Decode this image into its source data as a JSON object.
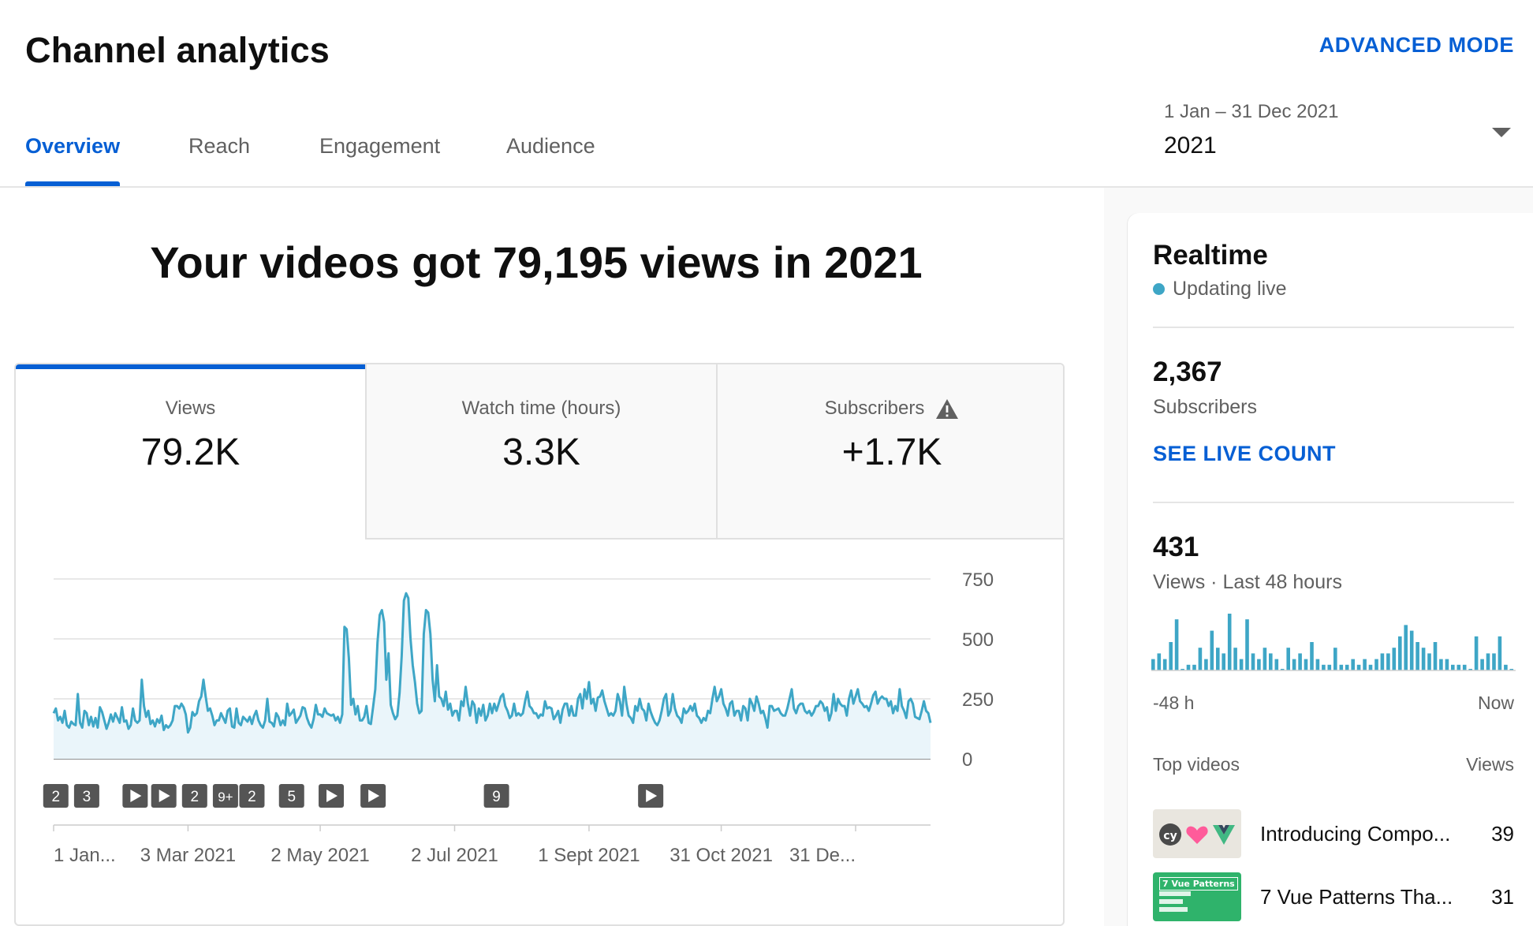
{
  "header": {
    "title": "Channel analytics",
    "advanced_mode": "ADVANCED MODE",
    "tabs": [
      "Overview",
      "Reach",
      "Engagement",
      "Audience"
    ],
    "active_tab": "Overview",
    "date_range": {
      "sub": "1 Jan – 31 Dec 2021",
      "value": "2021"
    }
  },
  "headline": "Your videos got 79,195 views in 2021",
  "metrics": [
    {
      "label": "Views",
      "value": "79.2K",
      "active": true
    },
    {
      "label": "Watch time (hours)",
      "value": "3.3K",
      "active": false
    },
    {
      "label": "Subscribers",
      "value": "+1.7K",
      "active": false,
      "warning_icon": "warning-icon"
    }
  ],
  "chart_data": {
    "type": "area",
    "series": [
      {
        "values": [
          190,
          210,
          160,
          175,
          150,
          200,
          140,
          130,
          155,
          145,
          140,
          270,
          150,
          130,
          200,
          190,
          140,
          175,
          135,
          170,
          130,
          215,
          195,
          160,
          125,
          150,
          185,
          155,
          190,
          170,
          150,
          215,
          155,
          160,
          125,
          140,
          210,
          160,
          150,
          160,
          330,
          220,
          175,
          200,
          145,
          160,
          135,
          165,
          150,
          180,
          120,
          140,
          130,
          140,
          160,
          220,
          220,
          210,
          230,
          215,
          185,
          110,
          130,
          195,
          180,
          190,
          240,
          260,
          330,
          260,
          200,
          210,
          180,
          140,
          160,
          160,
          190,
          170,
          150,
          200,
          210,
          135,
          130,
          210,
          150,
          140,
          175,
          165,
          155,
          175,
          145,
          180,
          200,
          160,
          140,
          130,
          160,
          250,
          155,
          150,
          135,
          190,
          175,
          140,
          160,
          140,
          230,
          180,
          190,
          205,
          150,
          165,
          180,
          215,
          210,
          170,
          145,
          130,
          165,
          225,
          185,
          185,
          175,
          210,
          190,
          185,
          180,
          185,
          160,
          175,
          150,
          185,
          550,
          540,
          420,
          225,
          250,
          185,
          220,
          160,
          160,
          175,
          220,
          150,
          145,
          215,
          290,
          485,
          600,
          620,
          570,
          330,
          440,
          225,
          190,
          165,
          180,
          275,
          430,
          660,
          690,
          670,
          500,
          390,
          320,
          230,
          190,
          200,
          520,
          620,
          610,
          520,
          330,
          240,
          390,
          260,
          250,
          220,
          280,
          205,
          230,
          180,
          200,
          200,
          160,
          240,
          220,
          300,
          230,
          180,
          240,
          225,
          150,
          210,
          180,
          225,
          160,
          180,
          230,
          190,
          230,
          200,
          230,
          260,
          270,
          220,
          200,
          170,
          180,
          230,
          180,
          190,
          180,
          190,
          240,
          280,
          220,
          210,
          190,
          190,
          170,
          185,
          180,
          240,
          210,
          215,
          210,
          165,
          180,
          200,
          150,
          205,
          230,
          230,
          180,
          220,
          180,
          180,
          250,
          270,
          210,
          290,
          250,
          320,
          230,
          250,
          200,
          255,
          260,
          285,
          240,
          210,
          180,
          190,
          180,
          200,
          270,
          240,
          180,
          300,
          230,
          180,
          170,
          150,
          220,
          200,
          250,
          210,
          200,
          160,
          230,
          195,
          170,
          150,
          140,
          160,
          200,
          250,
          270,
          180,
          200,
          270,
          210,
          180,
          170,
          150,
          210,
          190,
          200,
          220,
          200,
          230,
          180,
          170,
          150,
          170,
          160,
          200,
          190,
          250,
          300,
          240,
          260,
          290,
          230,
          210,
          180,
          230,
          240,
          180,
          200,
          200,
          160,
          220,
          210,
          160,
          250,
          230,
          200,
          260,
          230,
          190,
          200,
          170,
          130,
          220,
          220,
          200,
          205,
          210,
          190,
          180,
          180,
          210,
          250,
          290,
          210,
          190,
          220,
          230,
          230,
          200,
          190,
          200,
          180,
          195,
          220,
          220,
          240,
          230,
          200,
          215,
          160,
          190,
          270,
          200,
          250,
          230,
          220,
          220,
          180,
          250,
          285,
          230,
          260,
          290,
          240,
          230,
          215,
          220,
          200,
          230,
          265,
          280,
          230,
          250,
          260,
          250,
          250,
          220,
          240,
          190,
          220,
          200,
          290,
          220,
          200,
          170,
          240,
          250,
          230,
          175,
          170,
          165,
          200,
          240,
          200,
          190,
          150
        ]
      }
    ],
    "x_tick_labels": [
      "1 Jan...",
      "3 Mar 2021",
      "2 May 2021",
      "2 Jul 2021",
      "1 Sept 2021",
      "31 Oct 2021",
      "31 De..."
    ],
    "y_tick_labels": [
      "0",
      "250",
      "500",
      "750"
    ],
    "ylim": [
      0,
      750
    ],
    "color": "#3ea6c6",
    "fill": "#eaf5fa",
    "markers": [
      {
        "day": 1,
        "label": "2"
      },
      {
        "day": 15,
        "label": "3"
      },
      {
        "day": 37,
        "label": "play"
      },
      {
        "day": 50,
        "label": "play"
      },
      {
        "day": 64,
        "label": "2"
      },
      {
        "day": 78,
        "label": "9+"
      },
      {
        "day": 90,
        "label": "2"
      },
      {
        "day": 108,
        "label": "5"
      },
      {
        "day": 126,
        "label": "play"
      },
      {
        "day": 145,
        "label": "play"
      },
      {
        "day": 201,
        "label": "9"
      },
      {
        "day": 271,
        "label": "play"
      }
    ]
  },
  "realtime": {
    "title": "Realtime",
    "live": "Updating live",
    "subscribers_value": "2,367",
    "subscribers_label": "Subscribers",
    "see_live": "SEE LIVE COUNT",
    "views_value": "431",
    "views_label": "Views · Last 48 hours",
    "bars": [
      2,
      3,
      2,
      5,
      9,
      0,
      1,
      1,
      4,
      2,
      7,
      4,
      3,
      10,
      4,
      2,
      9,
      3,
      2,
      4,
      3,
      2,
      0,
      4,
      2,
      3,
      2,
      5,
      2,
      1,
      1,
      4,
      1,
      1,
      2,
      1,
      2,
      1,
      2,
      3,
      3,
      4,
      6,
      8,
      7,
      5,
      4,
      3,
      5,
      2,
      2,
      1,
      1,
      1,
      0,
      6,
      2,
      3,
      3,
      6,
      1,
      0
    ],
    "axis_left": "-48 h",
    "axis_right": "Now",
    "top_videos_label": "Top videos",
    "views_col": "Views",
    "top_videos": [
      {
        "title": "Introducing Compo...",
        "views": "39",
        "thumb_icons": "cypress-heart-vue-logos"
      },
      {
        "title": "7 Vue Patterns Tha...",
        "views": "31",
        "thumb_text": "7 Vue Patterns"
      }
    ]
  }
}
